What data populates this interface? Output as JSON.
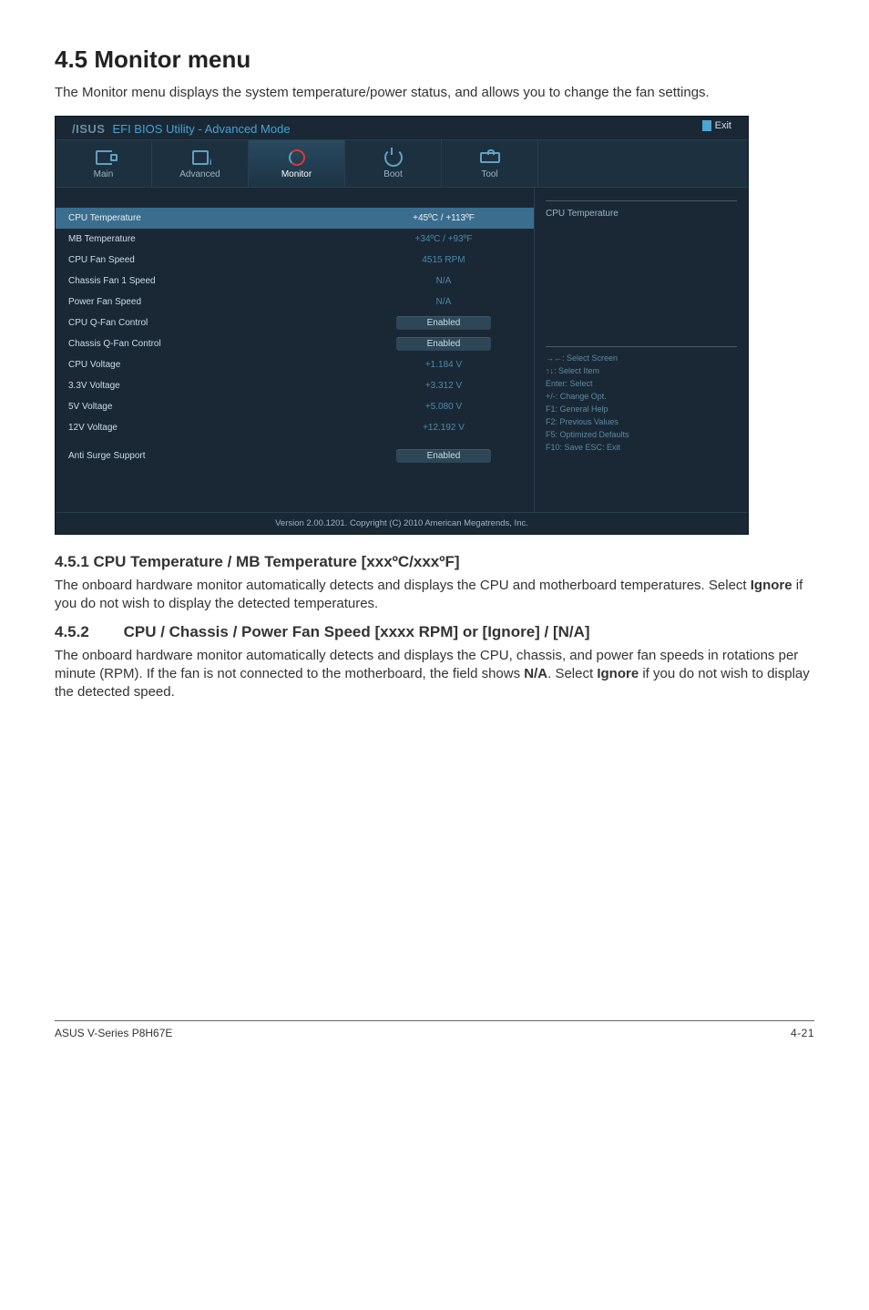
{
  "section": {
    "number_title": "4.5        Monitor menu",
    "intro": "The Monitor menu displays the system temperature/power status, and allows you to change the fan settings."
  },
  "bios": {
    "brand": "/ISUS",
    "header_text": "EFI BIOS Utility - Advanced Mode",
    "exit_label": "Exit",
    "tabs": {
      "main": "Main",
      "advanced": "Advanced",
      "monitor": "Monitor",
      "boot": "Boot",
      "tool": "Tool"
    },
    "rows": {
      "cpu_temp_label": "CPU Temperature",
      "cpu_temp_value": "+45ºC / +113ºF",
      "mb_temp_label": "MB Temperature",
      "mb_temp_value": "+34ºC / +93ºF",
      "cpu_fan_label": "CPU Fan Speed",
      "cpu_fan_value": "4515 RPM",
      "ch_fan1_label": "Chassis Fan 1 Speed",
      "ch_fan1_value": "N/A",
      "pwr_fan_label": "Power Fan Speed",
      "pwr_fan_value": "N/A",
      "cpu_qfan_label": "CPU Q-Fan Control",
      "cpu_qfan_value": "Enabled",
      "ch_qfan_label": "Chassis Q-Fan Control",
      "ch_qfan_value": "Enabled",
      "cpu_volt_label": "CPU Voltage",
      "cpu_volt_value": "+1.184 V",
      "v33_label": "3.3V Voltage",
      "v33_value": "+3.312 V",
      "v5_label": "5V Voltage",
      "v5_value": "+5.080 V",
      "v12_label": "12V Voltage",
      "v12_value": "+12.192 V",
      "anti_label": "Anti Surge Support",
      "anti_value": "Enabled"
    },
    "right": {
      "title": "CPU Temperature",
      "hints": {
        "h1": "→←: Select Screen",
        "h2": "↑↓: Select Item",
        "h3": "Enter: Select",
        "h4": "+/-: Change Opt.",
        "h5": "F1: General Help",
        "h6": "F2: Previous Values",
        "h7": "F5: Optimized Defaults",
        "h8": "F10: Save   ESC: Exit"
      }
    },
    "footer": "Version 2.00.1201.  Copyright (C) 2010 American Megatrends, Inc."
  },
  "sub1": {
    "heading": "4.5.1        CPU Temperature / MB Temperature [xxxºC/xxxºF]",
    "text_a": "The onboard hardware monitor automatically detects and displays the CPU and motherboard temperatures. Select ",
    "text_bold": "Ignore",
    "text_b": " if you do not wish to display the detected temperatures."
  },
  "sub2": {
    "heading": "4.5.2        CPU / Chassis / Power Fan Speed [xxxx RPM] or [Ignore] / [N/A]",
    "text_a": "The onboard hardware monitor automatically detects and displays the CPU, chassis, and power fan speeds in rotations per minute (RPM). If the fan is not connected to the motherboard, the field shows ",
    "bold1": "N/A",
    "text_b": ". Select ",
    "bold2": "Ignore",
    "text_c": " if you do not wish to display the detected speed."
  },
  "footer": {
    "left": "ASUS V-Series P8H67E",
    "right": "4-21"
  }
}
